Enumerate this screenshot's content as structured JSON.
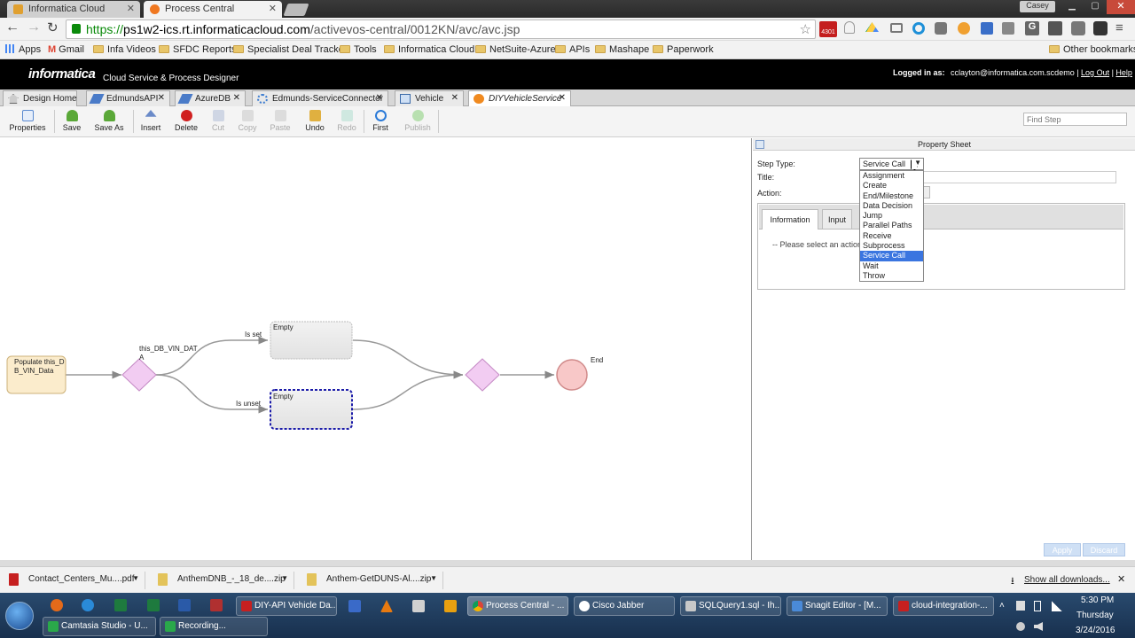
{
  "browser": {
    "tabs": [
      {
        "title": "Informatica Cloud"
      },
      {
        "title": "Process Central"
      }
    ],
    "user_badge": "Casey",
    "url": {
      "https": "https://",
      "domain": "ps1w2-ics.rt.informaticacloud.com",
      "path": "/activevos-central/0012KN/avc/avc.jsp"
    },
    "ext_badge": "4301",
    "bookmarks": [
      "Apps",
      "Gmail",
      "Infa Videos",
      "SFDC Reports",
      "Specialist Deal Tracke",
      "Tools",
      "Informatica Cloud",
      "NetSuite-Azure",
      "APIs",
      "Mashape",
      "Paperwork"
    ],
    "other_bookmarks": "Other bookmarks"
  },
  "app": {
    "logo": "informatica",
    "subtitle": "Cloud Service & Process Designer",
    "logged_in_label": "Logged in as:",
    "user": "cclayton@informatica.com.scdemo",
    "logout": "Log Out",
    "help": "Help"
  },
  "design_tabs": [
    {
      "label": "Design Home"
    },
    {
      "label": "EdmundsAPI"
    },
    {
      "label": "AzureDB"
    },
    {
      "label": "Edmunds-ServiceConnector"
    },
    {
      "label": "Vehicle"
    },
    {
      "label": "DIYVehicleService"
    }
  ],
  "toolbar": {
    "properties": "Properties",
    "save": "Save",
    "save_as": "Save As",
    "insert": "Insert",
    "delete": "Delete",
    "cut": "Cut",
    "copy": "Copy",
    "paste": "Paste",
    "undo": "Undo",
    "redo": "Redo",
    "first": "First",
    "publish": "Publish",
    "find_placeholder": "Find Step"
  },
  "canvas": {
    "start_label": "Populate this_DB_VIN_Data",
    "decision_label": "this_DB_VIN_DATA",
    "branch_set": "Is set",
    "branch_unset": "Is unset",
    "empty1": "Empty",
    "empty2": "Empty",
    "end_label": "End"
  },
  "property_sheet": {
    "title": "Property Sheet",
    "step_type_label": "Step Type:",
    "step_type_value": "Service Call",
    "title_label": "Title:",
    "action_label": "Action:",
    "tab_info": "Information",
    "tab_input": "Input",
    "hint": "-- Please select an action",
    "options": [
      "Assignment",
      "Create",
      "End/Milestone",
      "Data Decision",
      "Jump",
      "Parallel Paths",
      "Receive",
      "Subprocess",
      "Service Call",
      "Wait",
      "Throw"
    ],
    "selected_index": 8,
    "apply": "Apply",
    "discard": "Discard"
  },
  "downloads": {
    "items": [
      "Contact_Centers_Mu....pdf",
      "AnthemDNB_-_18_de....zip",
      "Anthem-GetDUNS-Al....zip"
    ],
    "show_all": "Show all downloads..."
  },
  "taskbar": {
    "row1": [
      "DIY-API Vehicle Da...",
      "Process Central - ...",
      "Cisco Jabber",
      "SQLQuery1.sql - Ih...",
      "Snagit Editor - [M...",
      "cloud-integration-..."
    ],
    "row2": [
      "Camtasia Studio - U...",
      "Recording..."
    ],
    "time": "5:30 PM",
    "day": "Thursday",
    "date": "3/24/2016"
  }
}
